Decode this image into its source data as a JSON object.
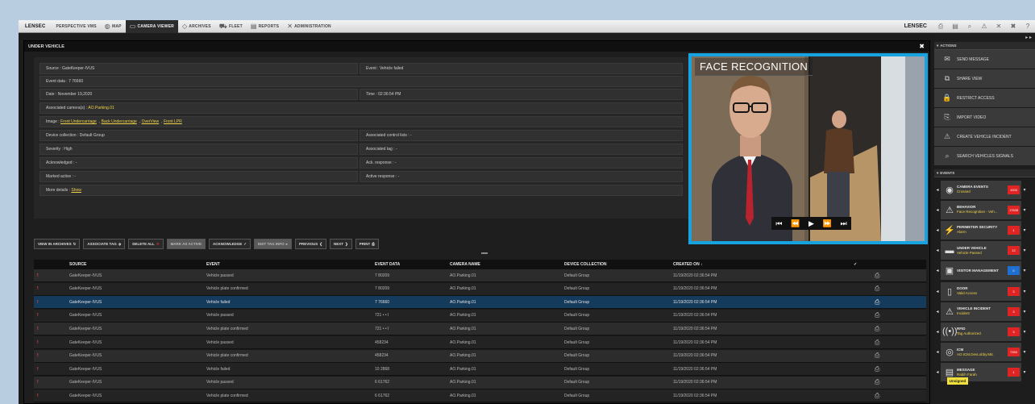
{
  "topbar": {
    "logo": "LENSEC",
    "tabs": [
      {
        "label": "PERSPECTIVE VMS",
        "icon": "",
        "active": false
      },
      {
        "label": "MAP",
        "icon": "map-icon",
        "active": false
      },
      {
        "label": "CAMERA VIEWER",
        "icon": "monitor-icon",
        "active": true
      },
      {
        "label": "ARCHIVES",
        "icon": "archive-icon",
        "active": false
      },
      {
        "label": "FLEET",
        "icon": "car-icon",
        "active": false
      },
      {
        "label": "REPORTS",
        "icon": "report-icon",
        "active": false
      },
      {
        "label": "ADMINISTRATION",
        "icon": "tools-icon",
        "active": false
      }
    ],
    "brand": "LENSEC"
  },
  "panel": {
    "title": "UNDER VEHICLE",
    "details": {
      "source": "Source : GateKeeper-IVUS",
      "event": "Event : Vehicle failed",
      "event_data": "Event data : 7 76660",
      "date": "Date : November 19,2020",
      "time": "Time : 02:36:54 PM",
      "cameras_label": "Associated camera(s) :",
      "cameras_value": "AO.Parking.01",
      "image_label": "Image :",
      "images": [
        "Front Undercarriage",
        "Back Undercarriage",
        "OverView",
        "Front LPR"
      ],
      "device_collection": "Device collection : Default Group",
      "control_lists": "Associated control lists : -",
      "severity": "Severity : High",
      "tags": "Associated tag : -",
      "acknowledged": "Acknowledged : -",
      "ack_response": "Ack. response : -",
      "marked_active": "Marked active : -",
      "active_response": "Active response : -",
      "more_label": "More details :",
      "more_link": "Show"
    },
    "actions": [
      {
        "label": "VIEW IN ARCHIVES",
        "glyph": "↻",
        "disabled": false
      },
      {
        "label": "ASSOCIATE TAG",
        "glyph": "⬗",
        "disabled": false
      },
      {
        "label": "DELETE ALL",
        "glyph": "✕",
        "disabled": false
      },
      {
        "label": "MARK AS ACTIVE",
        "glyph": "",
        "disabled": true
      },
      {
        "label": "ACKNOWLEDGE",
        "glyph": "✓",
        "disabled": false
      },
      {
        "label": "EDIT TAG INFO",
        "glyph": "▸",
        "disabled": true
      },
      {
        "label": "PREVIOUS",
        "glyph": "❮",
        "disabled": false
      },
      {
        "label": "NEXT",
        "glyph": "❯",
        "disabled": false
      },
      {
        "label": "PRINT",
        "glyph": "⎙",
        "disabled": false
      }
    ],
    "table": {
      "headers": [
        "SOURCE",
        "EVENT",
        "EVENT DATA",
        "CAMERA NAME",
        "DEVICE COLLECTION",
        "CREATED ON ↓",
        "✓"
      ],
      "rows": [
        {
          "sev": "!",
          "source": "GateKeeper-IVUS",
          "event": "Vehicle passed",
          "data": "7 80209",
          "camera": "AO.Parking.01",
          "collection": "Default Group",
          "created": "11/19/2020 02:36:54 PM"
        },
        {
          "sev": "!",
          "source": "GateKeeper-IVUS",
          "event": "Vehicle plate confirmed",
          "data": "7 80209",
          "camera": "AO.Parking.01",
          "collection": "Default Group",
          "created": "11/19/2020 02:36:54 PM"
        },
        {
          "sev": "!",
          "source": "GateKeeper-IVUS",
          "event": "Vehicle failed",
          "data": "7 76660",
          "camera": "AO.Parking.01",
          "collection": "Default Group",
          "created": "11/19/2020 02:36:54 PM"
        },
        {
          "sev": "!",
          "source": "GateKeeper-IVUS",
          "event": "Vehicle passed",
          "data": "721 • • I",
          "camera": "AO.Parking.01",
          "collection": "Default Group",
          "created": "11/19/2020 02:36:54 PM"
        },
        {
          "sev": "!",
          "source": "GateKeeper-IVUS",
          "event": "Vehicle plate confirmed",
          "data": "721 • • I",
          "camera": "AO.Parking.01",
          "collection": "Default Group",
          "created": "11/19/2020 02:36:54 PM"
        },
        {
          "sev": "!",
          "source": "GateKeeper-IVUS",
          "event": "Vehicle passed",
          "data": "458234",
          "camera": "AO.Parking.01",
          "collection": "Default Group",
          "created": "11/19/2020 02:36:54 PM"
        },
        {
          "sev": "!",
          "source": "GateKeeper-IVUS",
          "event": "Vehicle plate confirmed",
          "data": "458234",
          "camera": "AO.Parking.01",
          "collection": "Default Group",
          "created": "11/19/2020 02:36:54 PM"
        },
        {
          "sev": "!",
          "source": "GateKeeper-IVUS",
          "event": "Vehicle failed",
          "data": "10 2868",
          "camera": "AO.Parking.01",
          "collection": "Default Group",
          "created": "11/19/2020 02:36:54 PM"
        },
        {
          "sev": "!",
          "source": "GateKeeper-IVUS",
          "event": "Vehicle passed",
          "data": "6 61762",
          "camera": "AO.Parking.01",
          "collection": "Default Group",
          "created": "11/19/2020 02:36:54 PM"
        },
        {
          "sev": "!",
          "source": "GateKeeper-IVUS",
          "event": "Vehicle plate confirmed",
          "data": "6 61762",
          "camera": "AO.Parking.01",
          "collection": "Default Group",
          "created": "11/19/2020 02:36:54 PM"
        }
      ]
    }
  },
  "face": {
    "label": "FACE RECOGNITION",
    "controls": [
      "⏮",
      "⏪",
      "▶",
      "⏩",
      "⏭"
    ]
  },
  "sidebar": {
    "actions_title": "ACTIONS",
    "actions": [
      {
        "label": "SEND MESSAGE",
        "icon": "message-icon",
        "glyph": "✉"
      },
      {
        "label": "SHARE VIEW",
        "icon": "share-icon",
        "glyph": "⧉"
      },
      {
        "label": "RESTRICT ACCESS",
        "icon": "lock-icon",
        "glyph": "🔒"
      },
      {
        "label": "IMPORT VIDEO",
        "icon": "import-icon",
        "glyph": "⎘"
      },
      {
        "label": "CREATE VEHICLE INCIDENT",
        "icon": "vehicle-incident-icon",
        "glyph": "⚠"
      },
      {
        "label": "SEARCH VEHICLES SIGNALS",
        "icon": "search-vehicle-icon",
        "glyph": "⌕"
      }
    ],
    "events_title": "EVENTS",
    "events": [
      {
        "name": "CAMERA EVENTS",
        "sub": "Crossed",
        "badge": "1000",
        "color": "#e02424",
        "glyph": "◉",
        "icon": "camera-icon"
      },
      {
        "name": "BEHAVIOR",
        "sub": "Face Recognition - Veh...",
        "badge": "17835",
        "color": "#e02424",
        "glyph": "⚠",
        "icon": "warning-icon"
      },
      {
        "name": "PERIMETER SECURITY",
        "sub": "Alarm",
        "badge": "1",
        "color": "#e02424",
        "glyph": "⚡",
        "icon": "perimeter-icon"
      },
      {
        "name": "UNDER VEHICLE",
        "sub": "Vehicle Passed",
        "badge": "12",
        "color": "#e02424",
        "glyph": "▬",
        "icon": "under-vehicle-icon"
      },
      {
        "name": "VISITOR MANAGEMENT",
        "sub": "",
        "badge": "0",
        "color": "#1f6fd1",
        "glyph": "▣",
        "icon": "visitor-icon"
      },
      {
        "name": "DOOR",
        "sub": "Valid Access",
        "badge": "3",
        "color": "#e02424",
        "glyph": "▯",
        "icon": "door-icon"
      },
      {
        "name": "VEHICLE INCIDENT",
        "sub": "Incident",
        "badge": "3",
        "color": "#e02424",
        "glyph": "⚠",
        "icon": "incident-icon"
      },
      {
        "name": "RFID",
        "sub": "Tag Authorized",
        "badge": "3",
        "color": "#e02424",
        "glyph": "((•))",
        "icon": "rfid-icon"
      },
      {
        "name": "ICM",
        "sub": "AO.ICM.DevLobby.Mic",
        "badge": "7350",
        "color": "#e02424",
        "glyph": "◎",
        "icon": "intercom-icon"
      },
      {
        "name": "MESSAGE",
        "sub": "Rabih Farah",
        "badge": "1",
        "color": "#e02424",
        "glyph": "▤",
        "icon": "message-icon"
      }
    ],
    "tooltip": "Unsigned"
  }
}
